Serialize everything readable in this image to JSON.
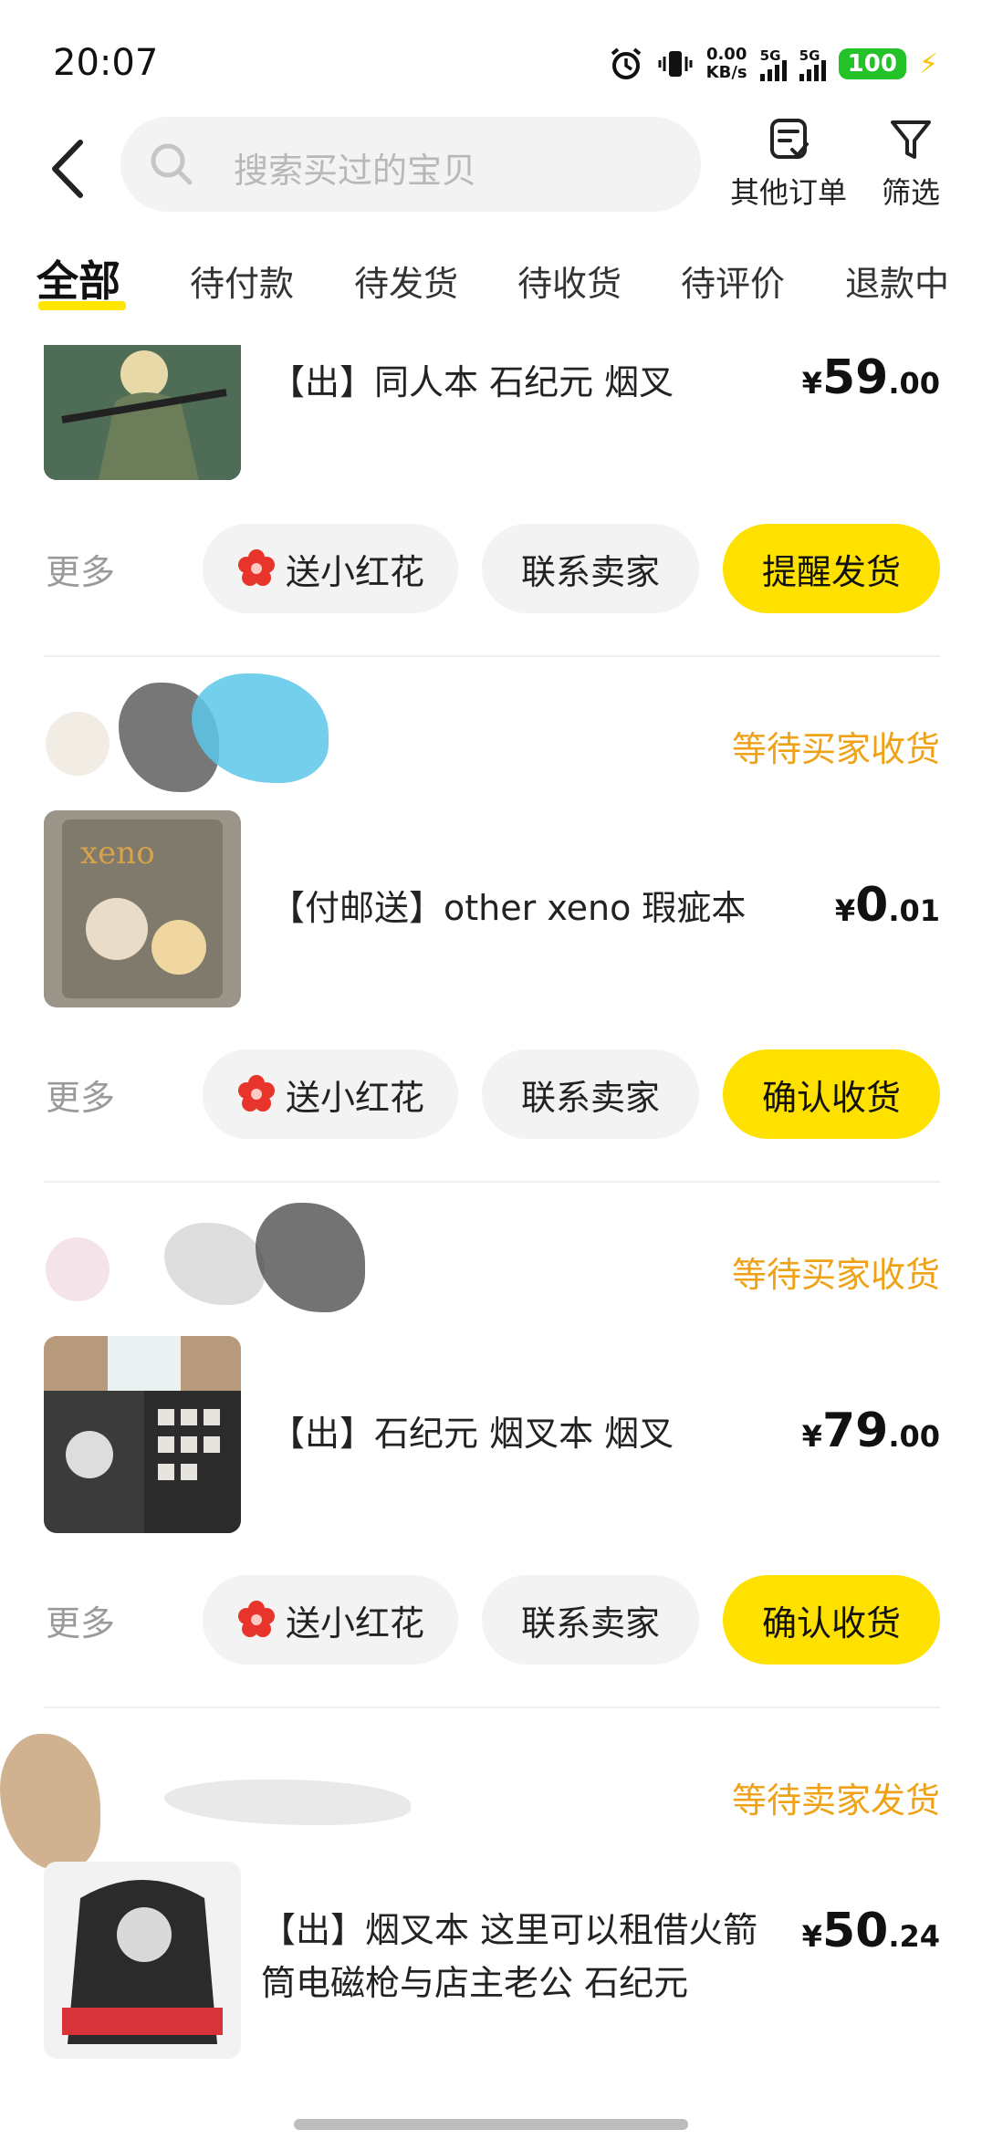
{
  "status": {
    "time": "20:07",
    "net_speed": "0.00",
    "net_unit": "KB/s",
    "sim1": "5G",
    "sim2": "5G",
    "battery": "100"
  },
  "search": {
    "placeholder": "搜索买过的宝贝"
  },
  "top_actions": {
    "other_orders": "其他订单",
    "filter": "筛选"
  },
  "tabs": [
    "全部",
    "待付款",
    "待发货",
    "待收货",
    "待评价",
    "退款中"
  ],
  "colors": {
    "accent": "#ffe100",
    "status_orange": "#f0a216",
    "flower_red": "#e8352c"
  },
  "orders": [
    {
      "status": "",
      "title": "【出】同人本 石纪元 烟叉",
      "price": {
        "currency": "¥",
        "int": "59",
        "dec": ".00"
      },
      "more": "更多",
      "buttons": [
        "送小红花",
        "联系卖家",
        "提醒发货"
      ]
    },
    {
      "status": "等待买家收货",
      "title": "【付邮送】other xeno 瑕疵本",
      "price": {
        "currency": "¥",
        "int": "0",
        "dec": ".01"
      },
      "more": "更多",
      "buttons": [
        "送小红花",
        "联系卖家",
        "确认收货"
      ]
    },
    {
      "status": "等待买家收货",
      "title": "【出】石纪元 烟叉本 烟叉",
      "price": {
        "currency": "¥",
        "int": "79",
        "dec": ".00"
      },
      "more": "更多",
      "buttons": [
        "送小红花",
        "联系卖家",
        "确认收货"
      ]
    },
    {
      "status": "等待卖家发货",
      "title": "【出】烟叉本 这里可以租借火箭筒电磁枪与店主老公 石纪元",
      "price": {
        "currency": "¥",
        "int": "50",
        "dec": ".24"
      }
    }
  ]
}
